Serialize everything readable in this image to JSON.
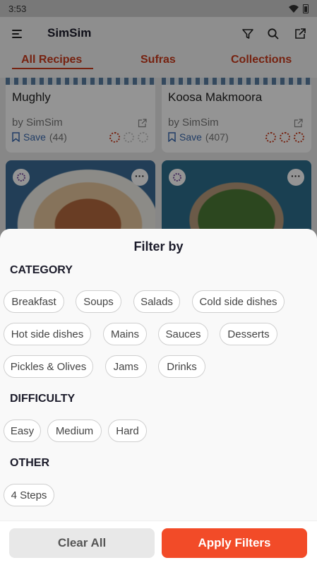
{
  "status": {
    "time": "3:53"
  },
  "app": {
    "title": "SimSim"
  },
  "tabs": [
    "All Recipes",
    "Sufras",
    "Collections"
  ],
  "recipes": [
    {
      "title": "Mughly",
      "author": "by SimSim",
      "save_label": "Save",
      "save_count": "(44)",
      "difficulty_level": 1
    },
    {
      "title": "Koosa Makmoora",
      "author": "by SimSim",
      "save_label": "Save",
      "save_count": "(407)",
      "difficulty_level": 3
    }
  ],
  "filter": {
    "title": "Filter by",
    "category": {
      "title": "CATEGORY",
      "options": [
        "Breakfast",
        "Soups",
        "Salads",
        "Cold side dishes",
        "Hot side dishes",
        "Mains",
        "Sauces",
        "Desserts",
        "Pickles & Olives",
        "Jams",
        "Drinks"
      ]
    },
    "difficulty": {
      "title": "DIFFICULTY",
      "options": [
        "Easy",
        "Medium",
        "Hard"
      ]
    },
    "other": {
      "title": "OTHER",
      "options": [
        "4 Steps"
      ]
    },
    "clear_label": "Clear All",
    "apply_label": "Apply Filters"
  },
  "colors": {
    "accent": "#cc3b1d",
    "apply": "#f24b28",
    "link": "#3a6ab0"
  }
}
